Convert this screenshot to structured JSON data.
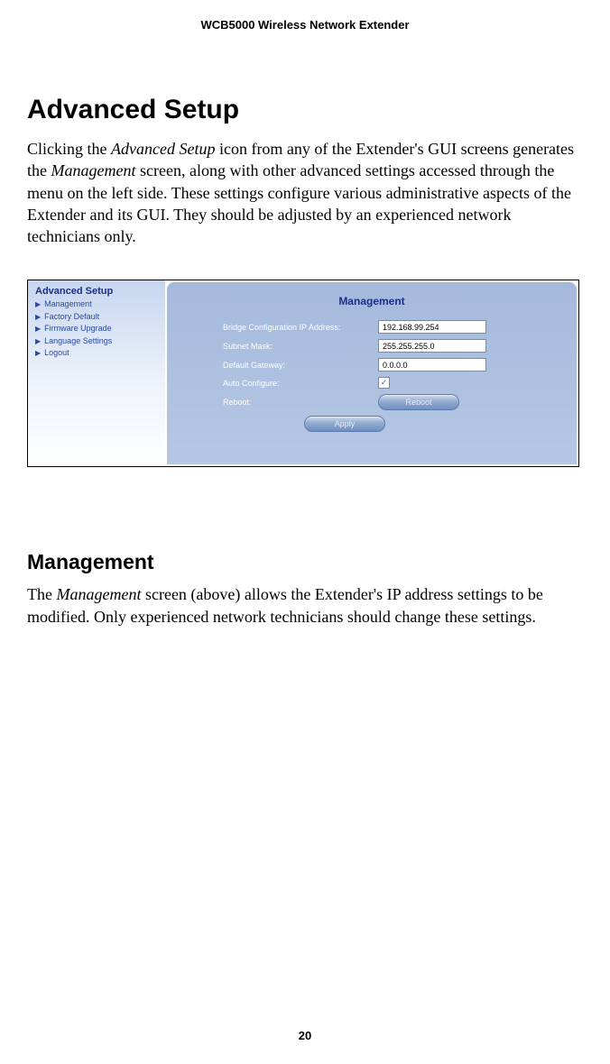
{
  "header": {
    "running_title": "WCB5000 Wireless Network Extender"
  },
  "section1": {
    "title": "Advanced Setup",
    "para_pre": "Clicking the ",
    "ital1": "Advanced Setup",
    "para_mid1": " icon from any of the Extender's GUI screens generates the ",
    "ital2": "Management",
    "para_post": " screen, along with other advanced settings accessed through the menu on the left side. These settings configure various administrative aspects of the Extender and its GUI. They should be adjusted by an experienced network technicians only."
  },
  "gui": {
    "sidebar": {
      "title": "Advanced Setup",
      "items": [
        {
          "label": "Management"
        },
        {
          "label": "Factory Default"
        },
        {
          "label": "Firmware Upgrade"
        },
        {
          "label": "Language Settings"
        },
        {
          "label": "Logout"
        }
      ]
    },
    "panel": {
      "title": "Management",
      "rows": {
        "ip_label": "Bridge Configuration IP Address:",
        "ip_value": "192.168.99.254",
        "mask_label": "Subnet Mask:",
        "mask_value": "255.255.255.0",
        "gw_label": "Default Gateway:",
        "gw_value": "0.0.0.0",
        "auto_label": "Auto Configure:",
        "auto_checked": "✓",
        "reboot_label": "Reboot:",
        "reboot_button": "Reboot",
        "apply_button": "Apply"
      }
    }
  },
  "section2": {
    "title": "Management",
    "para_pre": "The ",
    "ital1": "Management",
    "para_post": " screen (above) allows the Extender's IP address settings to be modified. Only experienced network technicians should change these settings."
  },
  "footer": {
    "page_number": "20"
  }
}
